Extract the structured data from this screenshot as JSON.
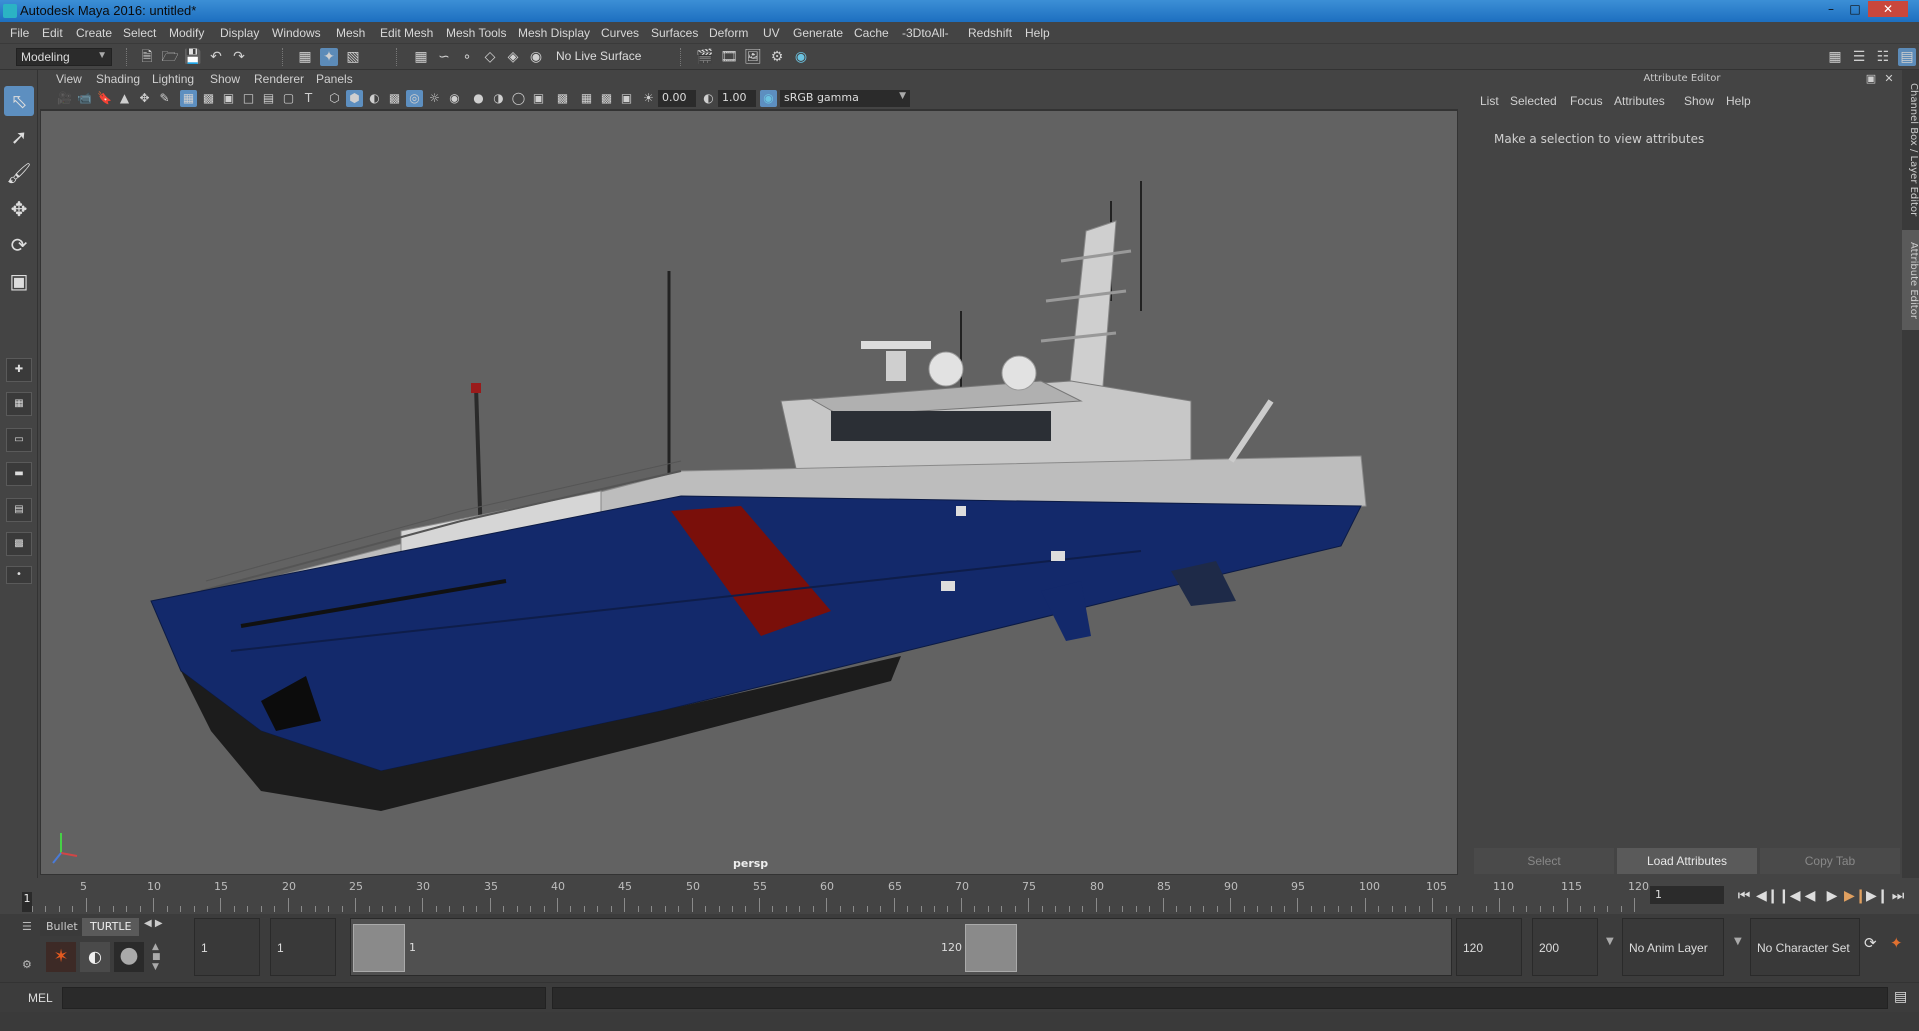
{
  "window": {
    "title": "Autodesk Maya 2016: untitled*"
  },
  "menus": [
    "File",
    "Edit",
    "Create",
    "Select",
    "Modify",
    "Display",
    "Windows",
    "Mesh",
    "Edit Mesh",
    "Mesh Tools",
    "Mesh Display",
    "Curves",
    "Surfaces",
    "Deform",
    "UV",
    "Generate",
    "Cache",
    "-3DtoAll-",
    "Redshift",
    "Help"
  ],
  "status": {
    "mode": "Modeling",
    "live_surface": "No Live Surface"
  },
  "panel_menu": [
    "View",
    "Shading",
    "Lighting",
    "Show",
    "Renderer",
    "Panels"
  ],
  "panel_toolbar": {
    "exposure": "0.00",
    "gamma": "1.00",
    "color_space": "sRGB gamma"
  },
  "viewport": {
    "camera_label": "persp"
  },
  "attribute_editor": {
    "title": "Attribute Editor",
    "menu": [
      "List",
      "Selected",
      "Focus",
      "Attributes",
      "Show",
      "Help"
    ],
    "message": "Make a selection to view attributes",
    "buttons": {
      "select": "Select",
      "load": "Load Attributes",
      "copy": "Copy Tab"
    }
  },
  "side_tabs": {
    "channel_box": "Channel Box / Layer Editor",
    "attribute_editor": "Attribute Editor"
  },
  "timeline": {
    "ticks": [
      "5",
      "10",
      "15",
      "20",
      "25",
      "30",
      "35",
      "40",
      "45",
      "50",
      "55",
      "60",
      "65",
      "70",
      "75",
      "80",
      "85",
      "90",
      "95",
      "100",
      "105",
      "110",
      "115",
      "120"
    ],
    "current_frame": "1",
    "frame_field": "1"
  },
  "range": {
    "start_field": "1",
    "start_anim": "1",
    "handle_start": "1",
    "handle_end": "120",
    "end_field": "120",
    "end_anim": "200",
    "anim_layer": "No Anim Layer",
    "character_set": "No Character Set"
  },
  "shelf": {
    "tab1": "Bullet",
    "tab2": "TURTLE"
  },
  "command": {
    "label": "MEL"
  },
  "colors": {
    "title_bar": "#2a80cf",
    "accent": "#5d8fc0",
    "hull_blue": "#13296b",
    "hull_red": "#7a0f0a",
    "hull_black": "#1c1c1c"
  }
}
